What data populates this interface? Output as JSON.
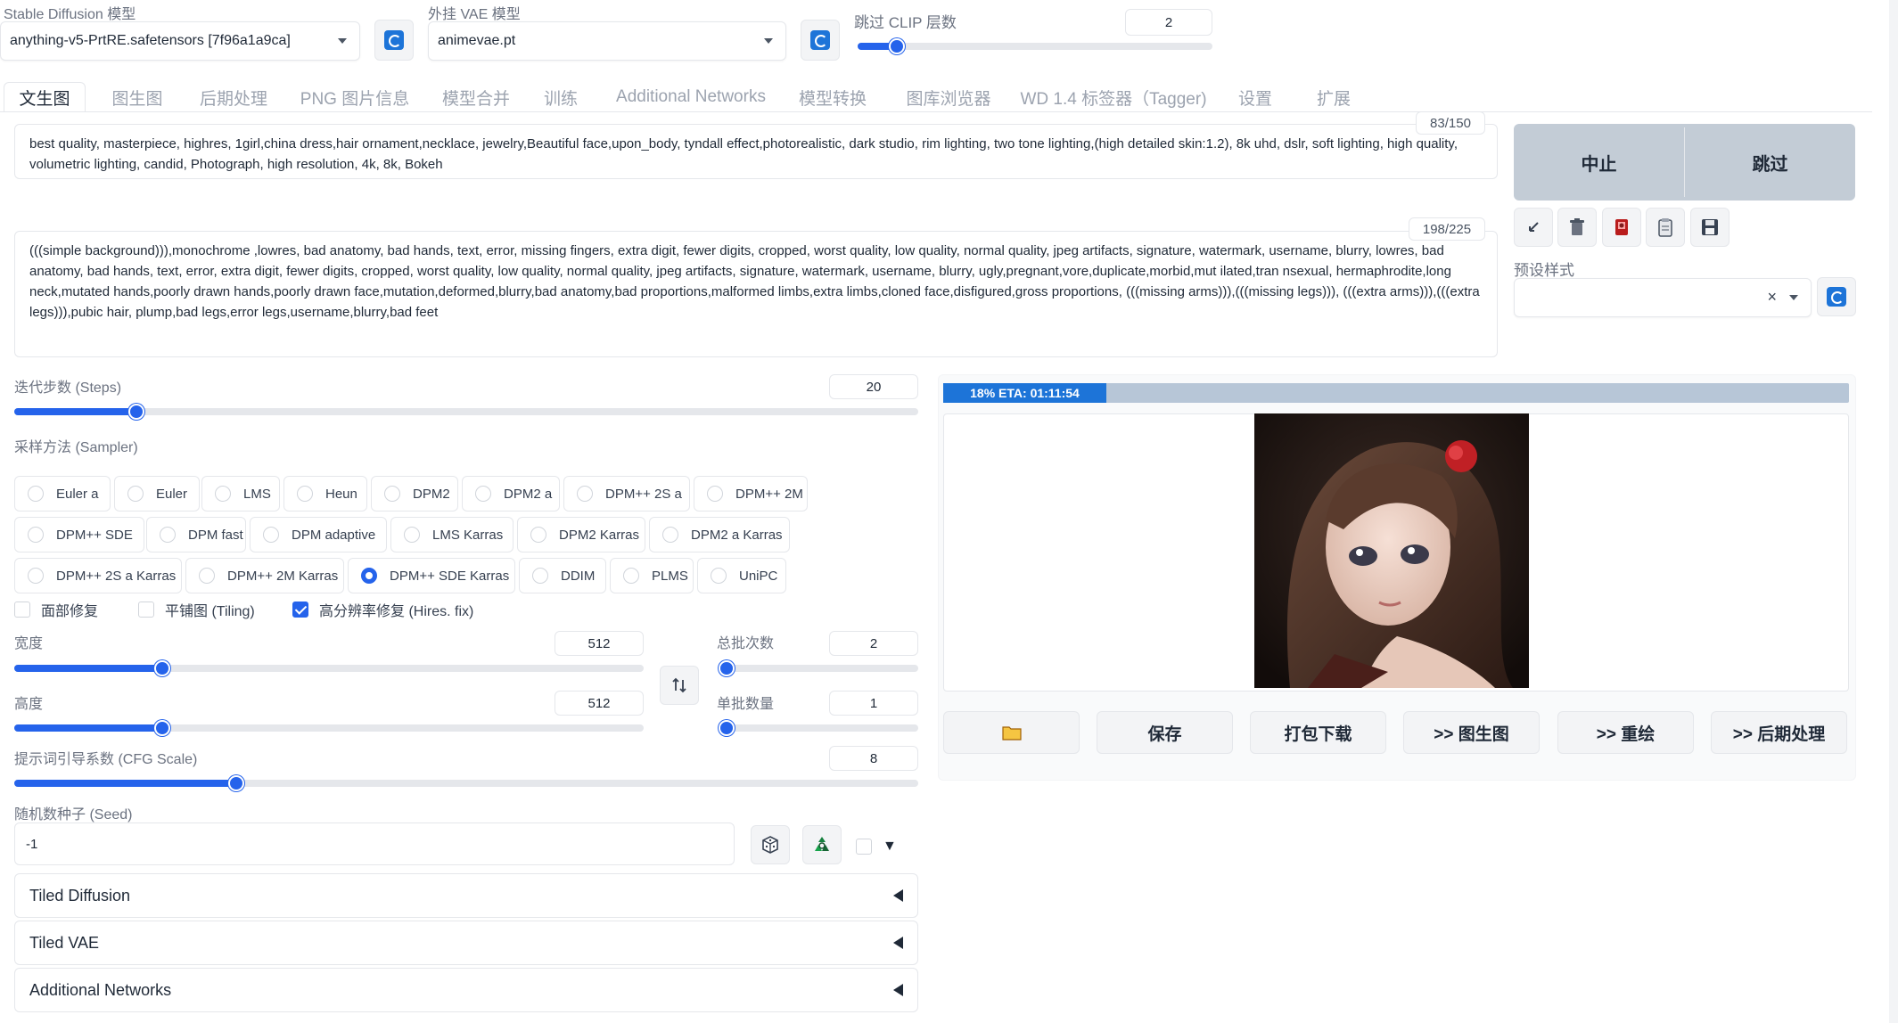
{
  "top": {
    "sd_model": {
      "label": "Stable Diffusion 模型",
      "value": "anything-v5-PrtRE.safetensors [7f96a1a9ca]"
    },
    "vae_model": {
      "label": "外挂 VAE 模型",
      "value": "animevae.pt"
    },
    "clip_skip": {
      "label": "跳过 CLIP 层数",
      "value": "2",
      "fraction": 0.11
    }
  },
  "tabs": [
    {
      "label": "文生图",
      "active": true
    },
    {
      "label": "图生图"
    },
    {
      "label": "后期处理"
    },
    {
      "label": "PNG 图片信息"
    },
    {
      "label": "模型合并"
    },
    {
      "label": "训练"
    },
    {
      "label": "Additional Networks"
    },
    {
      "label": "模型转换"
    },
    {
      "label": "图库浏览器"
    },
    {
      "label": "WD 1.4 标签器（Tagger)"
    },
    {
      "label": "设置"
    },
    {
      "label": "扩展"
    }
  ],
  "prompt": {
    "text": "best quality, masterpiece, highres, 1girl,china dress,hair ornament,necklace, jewelry,Beautiful face,upon_body, tyndall effect,photorealistic, dark studio, rim lighting, two tone lighting,(high detailed skin:1.2), 8k uhd, dslr, soft lighting, high quality, volumetric lighting, candid, Photograph, high resolution, 4k, 8k, Bokeh",
    "counter": "83/150"
  },
  "negative_prompt": {
    "text": "(((simple background))),monochrome ,lowres, bad anatomy, bad hands, text, error, missing fingers, extra digit, fewer digits, cropped, worst quality, low quality, normal quality, jpeg artifacts, signature, watermark, username, blurry, lowres, bad anatomy, bad hands, text, error, extra digit, fewer digits, cropped, worst quality, low quality, normal quality, jpeg artifacts, signature, watermark, username, blurry, ugly,pregnant,vore,duplicate,morbid,mut ilated,tran nsexual, hermaphrodite,long neck,mutated hands,poorly drawn hands,poorly drawn face,mutation,deformed,blurry,bad anatomy,bad proportions,malformed limbs,extra limbs,cloned face,disfigured,gross proportions, (((missing arms))),(((missing legs))), (((extra arms))),(((extra legs))),pubic hair, plump,bad legs,error legs,username,blurry,bad feet",
    "counter": "198/225"
  },
  "generate": {
    "interrupt_label": "中止",
    "skip_label": "跳过"
  },
  "styles": {
    "label": "预设样式",
    "clear": "×"
  },
  "steps": {
    "label": "迭代步数 (Steps)",
    "value": "20",
    "fraction": 0.135
  },
  "sampler": {
    "label": "采样方法 (Sampler)",
    "options": [
      "Euler a",
      "Euler",
      "LMS",
      "Heun",
      "DPM2",
      "DPM2 a",
      "DPM++ 2S a",
      "DPM++ 2M",
      "DPM++ SDE",
      "DPM fast",
      "DPM adaptive",
      "LMS Karras",
      "DPM2 Karras",
      "DPM2 a Karras",
      "DPM++ 2S a Karras",
      "DPM++ 2M Karras",
      "DPM++ SDE Karras",
      "DDIM",
      "PLMS",
      "UniPC"
    ],
    "selected": "DPM++ SDE Karras"
  },
  "checks": {
    "restore_faces": "面部修复",
    "tiling": "平铺图 (Tiling)",
    "hires_fix": "高分辨率修复 (Hires. fix)"
  },
  "width": {
    "label": "宽度",
    "value": "512",
    "fraction": 0.235
  },
  "height": {
    "label": "高度",
    "value": "512",
    "fraction": 0.235
  },
  "batch_count": {
    "label": "总批次数",
    "value": "2",
    "fraction": 0.0
  },
  "batch_size": {
    "label": "单批数量",
    "value": "1",
    "fraction": 0.0
  },
  "cfg": {
    "label": "提示词引导系数 (CFG Scale)",
    "value": "8",
    "fraction": 0.246
  },
  "seed": {
    "label": "随机数种子 (Seed)",
    "value": "-1",
    "extra_arrow": "▼"
  },
  "accordions": [
    "Tiled Diffusion",
    "Tiled VAE",
    "Additional Networks"
  ],
  "progress": {
    "text": "18% ETA: 01:11:54",
    "fraction": 0.18
  },
  "actions": [
    "保存",
    "打包下载",
    ">> 图生图",
    ">> 重绘",
    ">> 后期处理"
  ],
  "colors": {
    "accent": "#2563eb",
    "progress_bg": "#b7c6d7",
    "generate_bg": "#c3ccd6"
  }
}
